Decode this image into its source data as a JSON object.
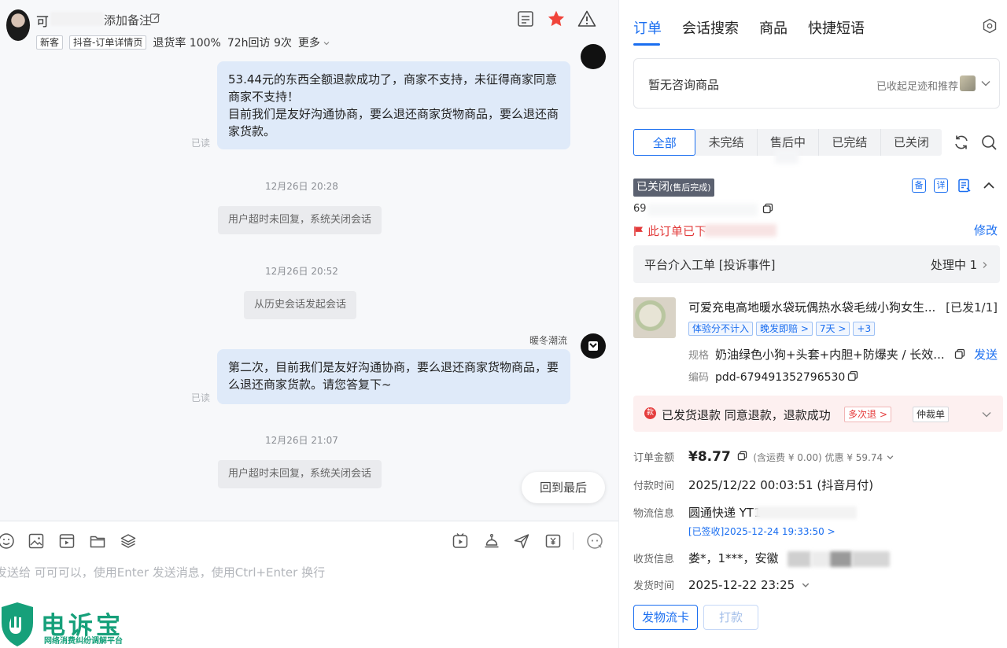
{
  "header": {
    "user_name": "可",
    "add_note": "添加备注",
    "tags": {
      "new_customer": "新客",
      "source": "抖音-订单详情页",
      "refund_rate": "退货率 100%",
      "revisit": "72h回访 9次",
      "more": "更多"
    }
  },
  "messages": {
    "first_bubble": "53.44元的东西全额退款成功了，商家不支持，未征得商家同意商家不支持！\n目前我们是友好沟通协商，要么退还商家货物商品，要么退还商家货款。",
    "read_label": "已读",
    "time_1": "12月26日 20:28",
    "system_timeout": "用户超时未回复，系统关闭会话",
    "time_2": "12月26日 20:52",
    "system_history": "从历史会话发起会话",
    "shop_name": "暖冬潮流",
    "second_bubble": "第二次，目前我们是友好沟通协商，要么退还商家货物商品，要么退还商家货款。请您答复下~",
    "time_3": "12月26日 21:07",
    "back_to_last": "回到最后"
  },
  "input": {
    "placeholder": "发送给 可可可以，使用Enter 发送消息，使用Ctrl+Enter 换行"
  },
  "watermark": {
    "brand": "电诉宝",
    "slogan": "网络消费纠纷调解平台"
  },
  "order_panel": {
    "tabs": [
      "订单",
      "会话搜索",
      "商品",
      "快捷短语"
    ],
    "consult_empty": "暂无咨询商品",
    "consult_hint": "已收起足迹和推荐",
    "filters": [
      "全部",
      "未完结",
      "售后中",
      "已完结",
      "已关闭"
    ],
    "status": "已关闭",
    "status_sub": "(售后完成)",
    "badge_note": "备",
    "badge_detail": "详",
    "order_id_prefix": "69",
    "flag_text": "此订单已下",
    "modify": "修改",
    "platform_left": "平台介入工单  [投诉事件]",
    "platform_right": "处理中 1",
    "product": {
      "title": "可爱充电高地暖水袋玩偶热水袋毛绒小狗女生...",
      "ship_status": "[已发1/1]",
      "tags": [
        "体验分不计入",
        "晚发即赔 >",
        "7天 >",
        "+3"
      ],
      "spec_label": "规格",
      "spec_value": "奶油绿色小狗+头套+内胆+防爆夹 / 长效...",
      "send": "发送",
      "code_label": "编码",
      "code_value": "pdd-679491352796530"
    },
    "refund": {
      "dot": "款",
      "text": "已发货退款  同意退款，退款成功",
      "multi": "多次退 >",
      "arbitration": "仲裁单"
    },
    "info": {
      "amount_label": "订单金额",
      "amount_value": "¥8.77",
      "amount_sub": "(含运费 ¥ 0.00) 优惠 ¥ 59.74",
      "paytime_label": "付款时间",
      "paytime_value": "2025/12/22 00:03:51 (抖音月付)",
      "logistics_label": "物流信息",
      "logistics_value": "圆通快递 YT1",
      "signed": "[已签收]2025-12-24 19:33:50 >",
      "receiver_label": "收货信息",
      "receiver_value": "娄*，1***，安徽",
      "shiptime_label": "发货时间",
      "shiptime_value": "2025-12-22 23:25"
    },
    "buttons": {
      "logistics_card": "发物流卡",
      "print": "打款"
    }
  },
  "colors": {
    "accent": "#1a6ef0",
    "bubble": "#dfeaf9",
    "star": "#f0443a",
    "danger": "#e53c3c",
    "brand_green": "#16a07a"
  }
}
